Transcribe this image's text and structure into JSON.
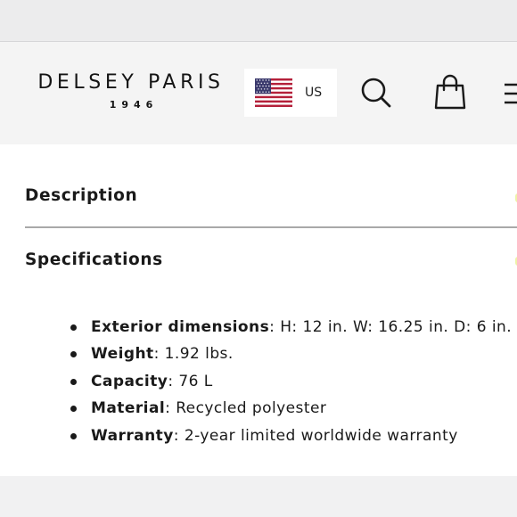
{
  "header": {
    "logo_main": "DELSEY PARIS",
    "logo_sub": "1946",
    "locale": {
      "flag": "us-flag-icon",
      "label": "US"
    },
    "icons": [
      "search-icon",
      "shopping-bag-icon",
      "menu-icon"
    ]
  },
  "sections": {
    "description": {
      "title": "Description"
    },
    "specifications": {
      "title": "Specifications",
      "items": [
        {
          "label": "Exterior dimensions",
          "value": ": H: 12 in. W: 16.25 in. D: 6 in."
        },
        {
          "label": "Weight",
          "value": ": 1.92 lbs."
        },
        {
          "label": "Capacity",
          "value": ": 76 L"
        },
        {
          "label": "Material",
          "value": ": Recycled polyester"
        },
        {
          "label": "Warranty",
          "value": ": 2-year limited worldwide warranty"
        }
      ]
    }
  },
  "colors": {
    "text": "#1a1a1a",
    "header_background": "#f4f4f4",
    "divider": "#a9a9a9",
    "accent_marker": "#eef3a8"
  }
}
